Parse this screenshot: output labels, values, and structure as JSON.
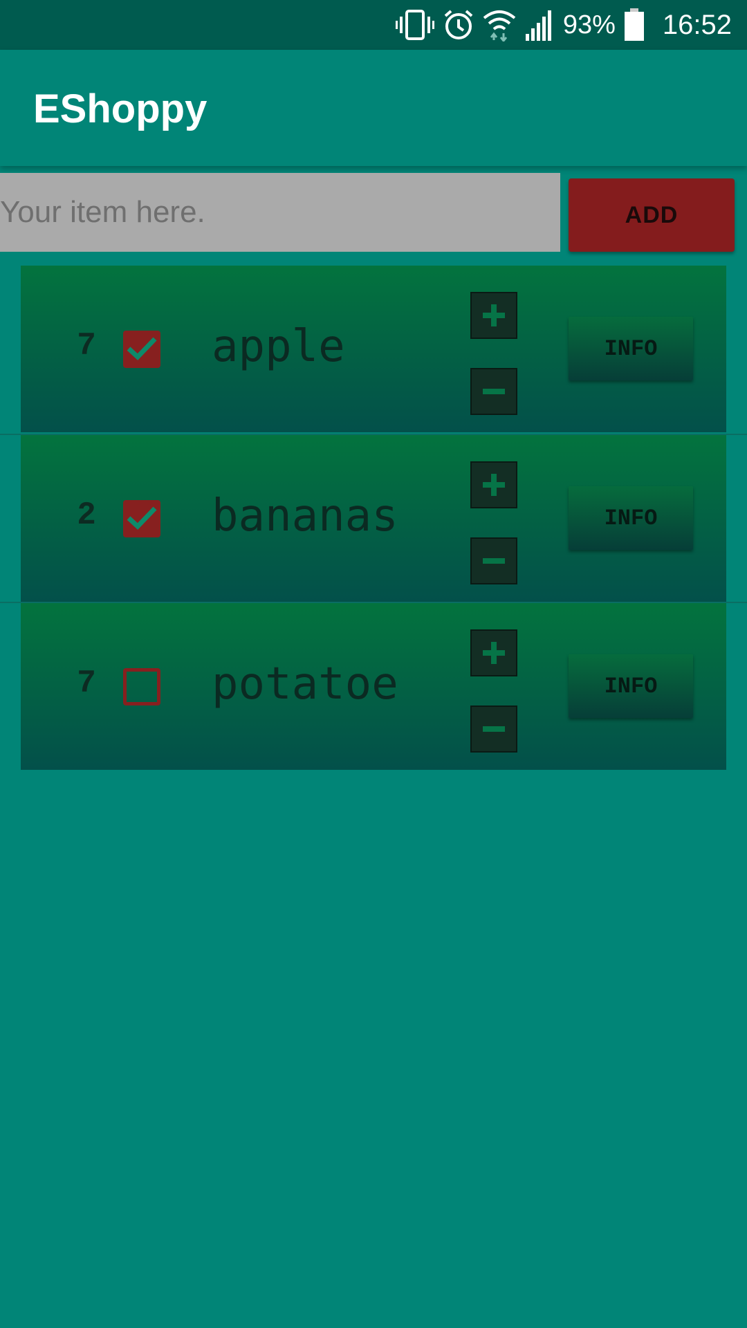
{
  "status_bar": {
    "battery_percent": "93%",
    "time": "16:52",
    "icons": [
      "vibrate-icon",
      "alarm-icon",
      "wifi-icon",
      "signal-icon",
      "battery-icon"
    ]
  },
  "app_bar": {
    "title": "EShoppy"
  },
  "add_item": {
    "placeholder": "Your item here.",
    "value": "",
    "add_label": "ADD"
  },
  "items": [
    {
      "quantity": "7",
      "checked": true,
      "name": "apple",
      "info_label": "INFO"
    },
    {
      "quantity": "2",
      "checked": true,
      "name": "bananas",
      "info_label": "INFO"
    },
    {
      "quantity": "7",
      "checked": false,
      "name": "potatoe",
      "info_label": "INFO"
    }
  ],
  "colors": {
    "status_bar": "#005b4f",
    "app_bar": "#018577",
    "accent": "#841c1d",
    "row_gradient_top": "#03733e",
    "row_gradient_bottom": "#03504a"
  }
}
